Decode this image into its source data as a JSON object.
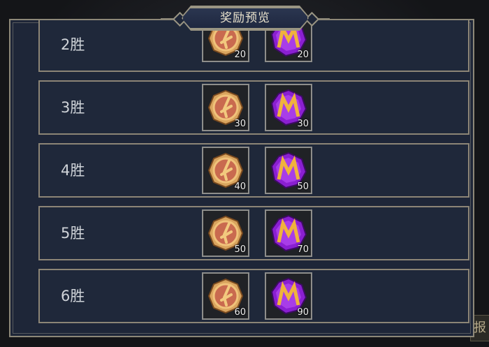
{
  "title": "奖励预览",
  "corner_glyph": "报",
  "rows": [
    {
      "label": "2胜",
      "coin_count": "20",
      "gem_count": "20"
    },
    {
      "label": "3胜",
      "coin_count": "30",
      "gem_count": "30"
    },
    {
      "label": "4胜",
      "coin_count": "40",
      "gem_count": "50"
    },
    {
      "label": "5胜",
      "coin_count": "50",
      "gem_count": "70"
    },
    {
      "label": "6胜",
      "coin_count": "60",
      "gem_count": "90"
    }
  ],
  "icons": {
    "coin": "bronze-coin-icon",
    "gem": "purple-m-gem-icon"
  },
  "colors": {
    "panel": "#1e2638",
    "border": "#8c8576",
    "gem": "#8a1fd1",
    "coin": "#c98a4a"
  }
}
